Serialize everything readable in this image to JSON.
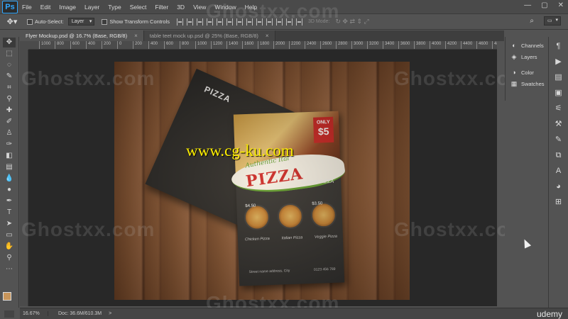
{
  "app": {
    "logo": "Ps",
    "menu": [
      "File",
      "Edit",
      "Image",
      "Layer",
      "Type",
      "Select",
      "Filter",
      "3D",
      "View",
      "Window",
      "Help"
    ],
    "window_controls": [
      "—",
      "▢",
      "✕"
    ]
  },
  "options_bar": {
    "auto_select_label": "Auto-Select:",
    "auto_select_value": "Layer",
    "show_transform_label": "Show Transform Controls",
    "mode_3d_label": "3D Mode:"
  },
  "tabs": [
    {
      "label": "Flyer Mockup.psd @ 16.7% (Base, RGB/8)",
      "close": "×"
    },
    {
      "label": "table teet mock up.psd @ 25% (Base, RGB/8)",
      "close": "×"
    }
  ],
  "ruler": [
    "1000",
    "800",
    "600",
    "400",
    "200",
    "0",
    "200",
    "400",
    "600",
    "800",
    "1000",
    "1200",
    "1400",
    "1600",
    "1800",
    "2000",
    "2200",
    "2400",
    "2600",
    "2800",
    "3000",
    "3200",
    "3400",
    "3600",
    "3800",
    "4000",
    "4200",
    "4400",
    "4600",
    "4800"
  ],
  "artwork": {
    "back_flyer_title": "PIZZA",
    "only_label": "ONLY",
    "price": "$5",
    "authentic": "Authentic Ital",
    "pizza": "PIZZA",
    "yummy": "Yummy! PIZZA",
    "slice_prices": [
      "$4.50",
      "",
      "$3.50"
    ],
    "slice_labels": [
      "Chicken Pizza",
      "Italian Pizza",
      "Veggie Pizza"
    ],
    "contact_left": "Street name address, City",
    "contact_right": "0123 456 789"
  },
  "watermarks": {
    "ghost": "Ghostxx.com",
    "cg": "www.cg-ku.com"
  },
  "panels": {
    "group1": [
      {
        "icon": "channels-icon",
        "label": "Channels"
      },
      {
        "icon": "layers-icon",
        "label": "Layers"
      }
    ],
    "group2": [
      {
        "icon": "color-icon",
        "label": "Color"
      },
      {
        "icon": "swatches-icon",
        "label": "Swatches"
      }
    ]
  },
  "status_bar": {
    "zoom": "16.67%",
    "doc": "Doc: 36.6M/610.3M",
    "arrow": ">",
    "brand": "udemy"
  },
  "colors": {
    "foreground": "#c8955a",
    "background": "#ffffff"
  }
}
